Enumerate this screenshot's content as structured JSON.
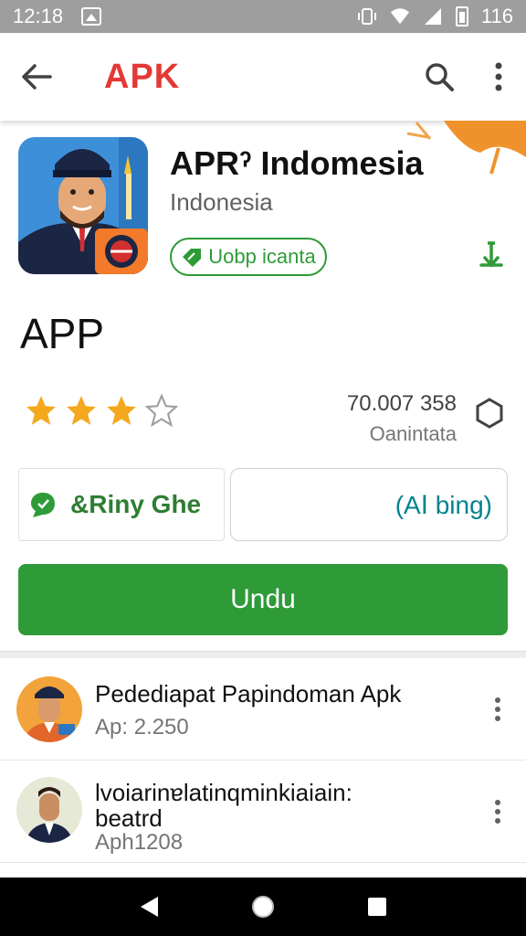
{
  "status_bar": {
    "time": "12:18",
    "battery_text": "116"
  },
  "app_bar": {
    "title": "APK"
  },
  "app": {
    "name": "APRˀ Indomesia",
    "developer": "Indonesia",
    "tag_label": "Uobp icanta"
  },
  "section_title": "APP",
  "rating": {
    "stars_filled": 3,
    "stars_total": 4
  },
  "downloads": {
    "count": "70.007 358",
    "label": "Oanintata"
  },
  "actions": {
    "left_label": "&Riny Ghe",
    "right_label": "(AⅠ bing)"
  },
  "download_button": {
    "label": "Undu"
  },
  "list": [
    {
      "title": "Pedediapat Papindoman Apk",
      "subtitle": "Ap: 2.250"
    },
    {
      "title": "lvoiarinɐlatinqminkiaiain:",
      "title2": "beatrd",
      "subtitle": "Aph1208"
    }
  ],
  "colors": {
    "accent_red": "#e53935",
    "brand_green": "#2e9b38",
    "star_gold": "#f4a81d"
  }
}
